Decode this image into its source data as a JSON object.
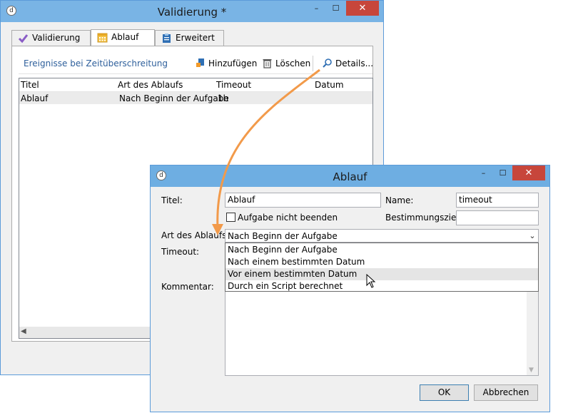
{
  "back_window": {
    "title": "Validierung *",
    "controls": {
      "minimize": "–",
      "maximize": "☐",
      "close": "✕"
    },
    "tabs": [
      {
        "label": "Validierung",
        "icon": "checkmark-icon"
      },
      {
        "label": "Ablauf",
        "icon": "calendar-icon"
      },
      {
        "label": "Erweitert",
        "icon": "clipboard-icon"
      }
    ],
    "toolbar": {
      "events_link": "Ereignisse bei Zeitüberschreitung",
      "add_label": "Hinzufügen",
      "delete_label": "Löschen",
      "details_label": "Details..."
    },
    "grid": {
      "columns": [
        "Titel",
        "Art des Ablaufs",
        "Timeout",
        "Datum"
      ],
      "rows": [
        {
          "title": "Ablauf",
          "type": "Nach Beginn der Aufgabe",
          "timeout": "1h",
          "date": ""
        }
      ]
    }
  },
  "front_window": {
    "title": "Ablauf",
    "controls": {
      "minimize": "–",
      "maximize": "☐",
      "close": "✕"
    },
    "labels": {
      "title": "Titel:",
      "name": "Name:",
      "checkbox": "Aufgabe nicht beenden",
      "target": "Bestimmungsziel:",
      "type": "Art des Ablaufs:",
      "timeout": "Timeout:",
      "comment": "Kommentar:"
    },
    "values": {
      "title": "Ablauf",
      "name": "timeout",
      "target": "",
      "type": "Nach Beginn der Aufgabe"
    },
    "dropdown_options": [
      "Nach Beginn der Aufgabe",
      "Nach einem bestimmten Datum",
      "Vor einem bestimmten Datum",
      "Durch ein Script berechnet"
    ],
    "buttons": {
      "ok": "OK",
      "cancel": "Abbrechen"
    }
  },
  "colors": {
    "titlebar": "#6eaee2",
    "close": "#c7463b",
    "link": "#2e5f9b",
    "annotation_arrow": "#f29a4a"
  }
}
